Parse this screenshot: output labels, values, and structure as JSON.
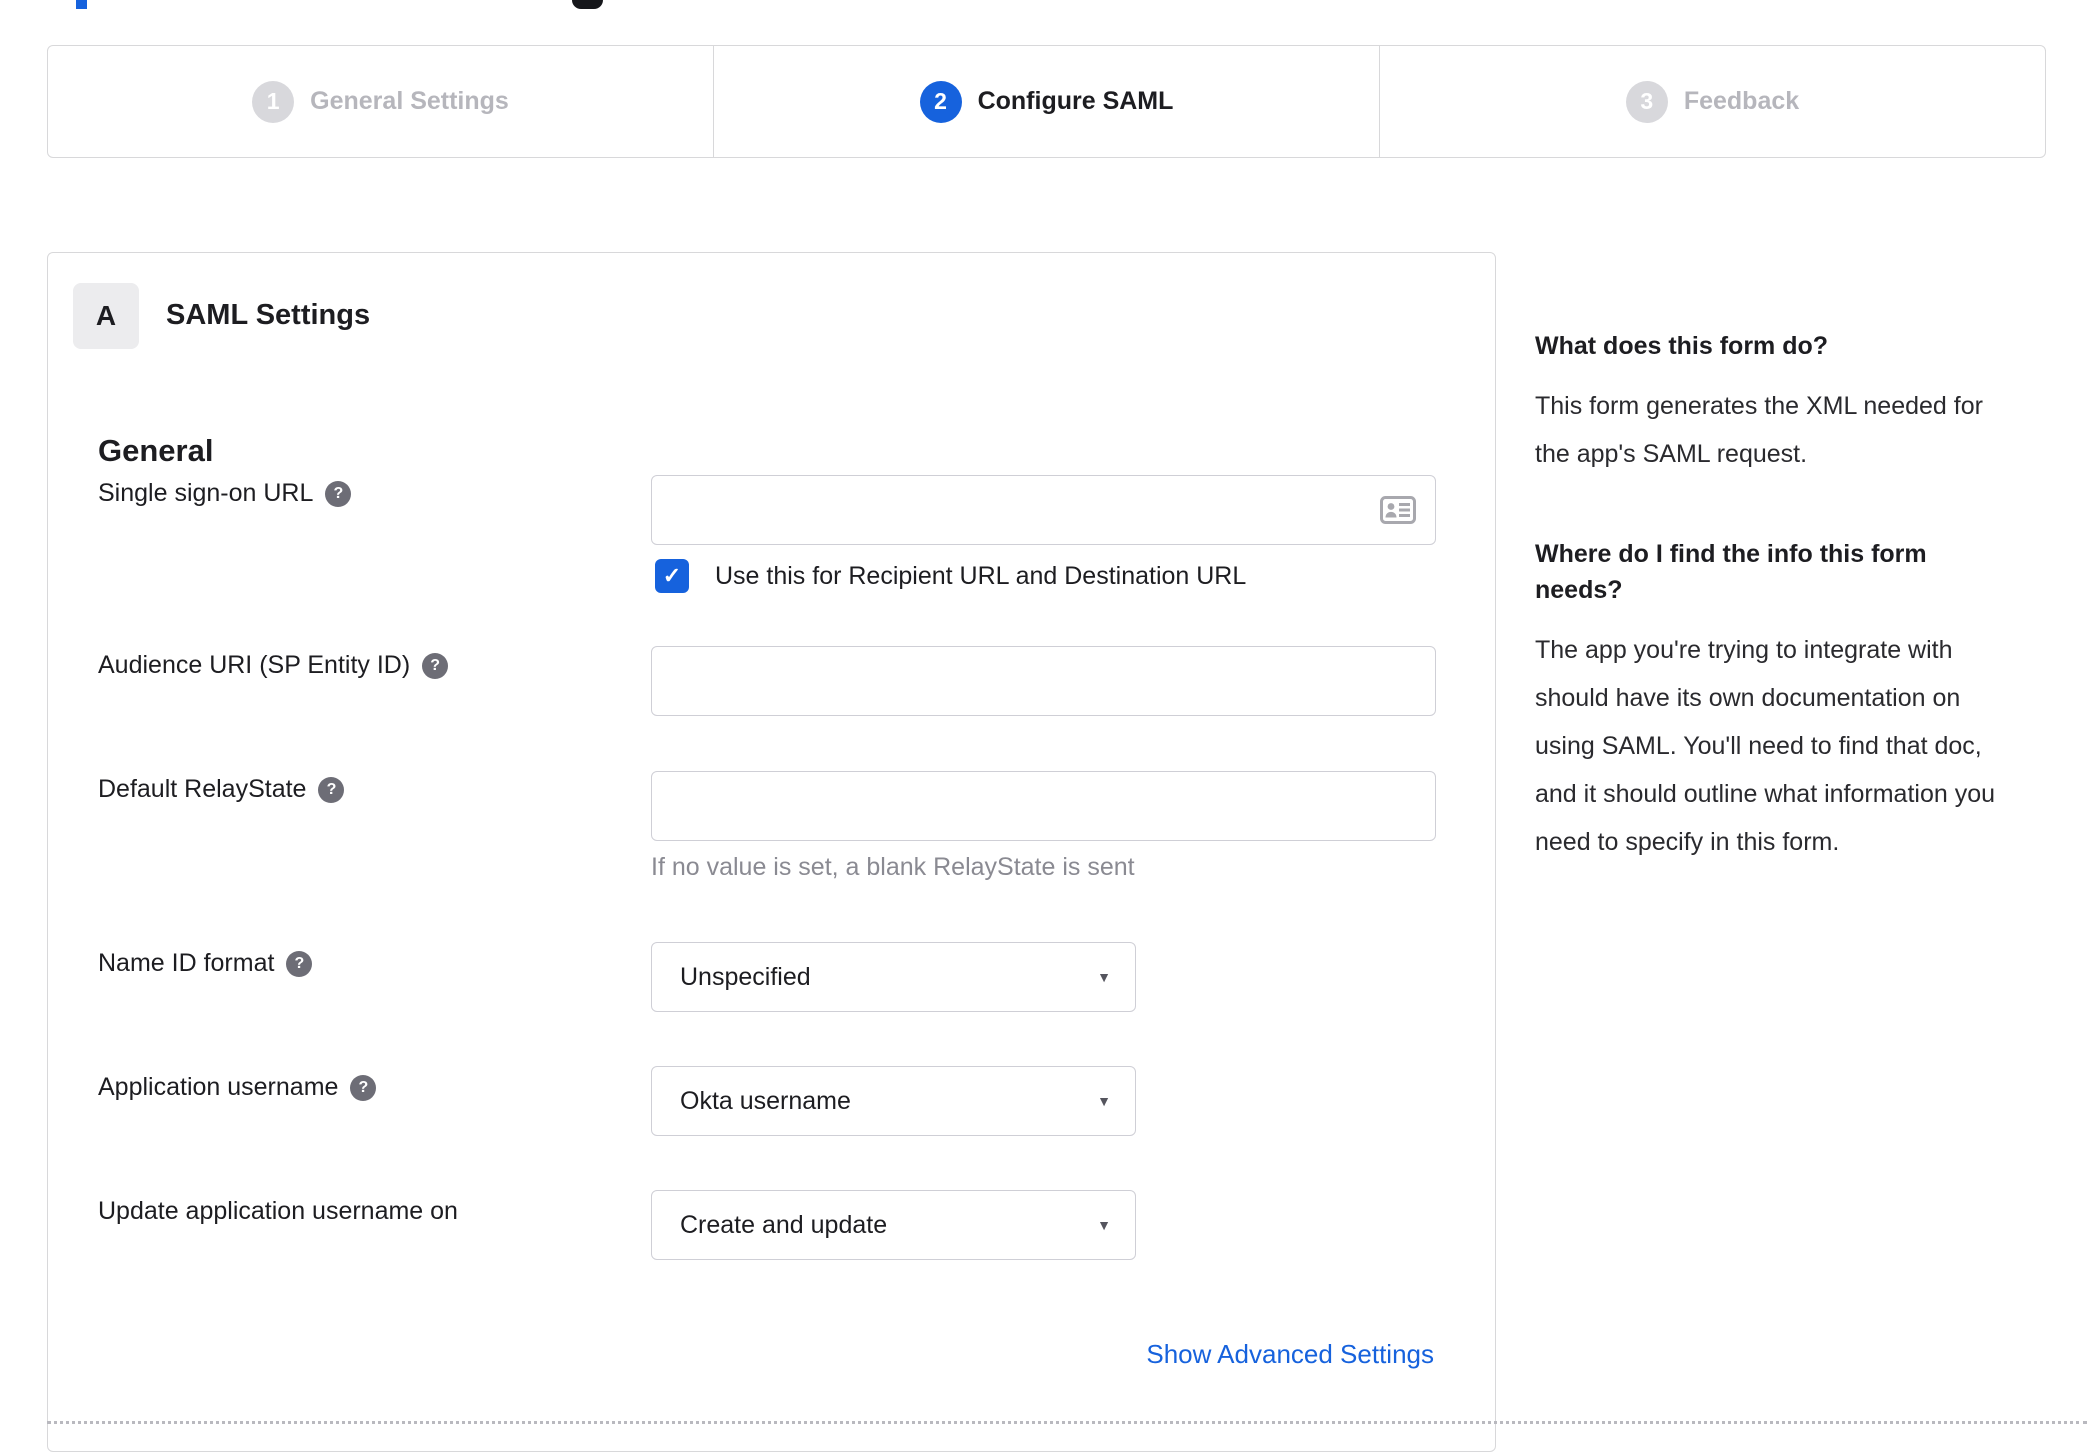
{
  "icons": {
    "check": "✓",
    "caret": "▼",
    "help": "?"
  },
  "colors": {
    "accent": "#1662dd",
    "step_inactive": "#b6b6bc",
    "link": "#1662dd"
  },
  "stepper": {
    "steps": [
      {
        "number": "1",
        "label": "General Settings",
        "active": false
      },
      {
        "number": "2",
        "label": "Configure SAML",
        "active": true
      },
      {
        "number": "3",
        "label": "Feedback",
        "active": false
      }
    ]
  },
  "panel": {
    "badge": "A",
    "title": "SAML Settings",
    "section_heading": "General",
    "fields": [
      {
        "label": "Single sign-on URL",
        "value": "",
        "checkbox_label": "Use this for Recipient URL and Destination URL",
        "checkbox_checked": true
      },
      {
        "label": "Audience URI (SP Entity ID)",
        "value": ""
      },
      {
        "label": "Default RelayState",
        "value": "",
        "hint": "If no value is set, a blank RelayState is sent"
      },
      {
        "label": "Name ID format",
        "value": "Unspecified"
      },
      {
        "label": "Application username",
        "value": "Okta username"
      },
      {
        "label": "Update application username on",
        "value": "Create and update"
      }
    ],
    "advanced_link": "Show Advanced Settings"
  },
  "sidebar": {
    "blocks": [
      {
        "heading": "What does this form do?",
        "body": "This form generates the XML needed for the app's SAML request."
      },
      {
        "heading": "Where do I find the info this form needs?",
        "body": "The app you're trying to integrate with should have its own documentation on using SAML. You'll need to find that doc, and it should outline what information you need to specify in this form."
      }
    ]
  }
}
